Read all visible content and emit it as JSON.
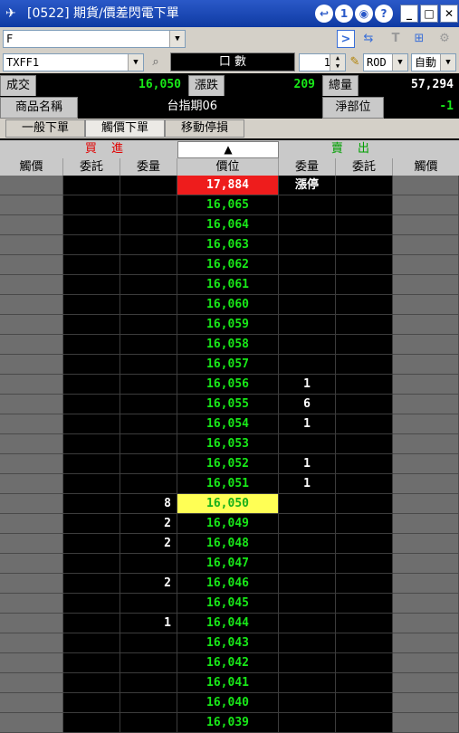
{
  "window": {
    "title": "[0522] 期貨/價差閃電下單",
    "buttons": [
      "↩",
      "1",
      "◉",
      "?"
    ]
  },
  "toolbar": {
    "account_value": "F",
    "symbol_value": "TXFF1",
    "qty_label": "口 數",
    "qty_value": "1",
    "order_type": "ROD",
    "mode": "自動"
  },
  "info": {
    "last_label": "成交",
    "last_value": "16,050",
    "change_label": "漲跌",
    "change_value": "209",
    "volume_label": "總量",
    "volume_value": "57,294",
    "name_label": "商品名稱",
    "name_value": "台指期06",
    "position_label": "淨部位",
    "position_value": "-1"
  },
  "tabs": [
    "一般下單",
    "觸價下單",
    "移動停損"
  ],
  "book_header": {
    "buy": "買 進",
    "sell": "賣 出",
    "center": "▲"
  },
  "columns": [
    "觸價",
    "委託",
    "委量",
    "價位",
    "委量",
    "委託",
    "觸價"
  ],
  "colors": {
    "price_green": "#18e818",
    "limit_up_bg": "#ee1c1c",
    "last_price_bg": "#ffff55",
    "buy_red": "#e00000",
    "sell_green": "#00a000"
  },
  "rows": [
    {
      "price": "17,884",
      "buy_qty": "",
      "sell_qty": "漲停",
      "state": "limit-up"
    },
    {
      "price": "16,065",
      "buy_qty": "",
      "sell_qty": "",
      "state": ""
    },
    {
      "price": "16,064",
      "buy_qty": "",
      "sell_qty": "",
      "state": ""
    },
    {
      "price": "16,063",
      "buy_qty": "",
      "sell_qty": "",
      "state": ""
    },
    {
      "price": "16,062",
      "buy_qty": "",
      "sell_qty": "",
      "state": ""
    },
    {
      "price": "16,061",
      "buy_qty": "",
      "sell_qty": "",
      "state": ""
    },
    {
      "price": "16,060",
      "buy_qty": "",
      "sell_qty": "",
      "state": ""
    },
    {
      "price": "16,059",
      "buy_qty": "",
      "sell_qty": "",
      "state": ""
    },
    {
      "price": "16,058",
      "buy_qty": "",
      "sell_qty": "",
      "state": ""
    },
    {
      "price": "16,057",
      "buy_qty": "",
      "sell_qty": "",
      "state": ""
    },
    {
      "price": "16,056",
      "buy_qty": "",
      "sell_qty": "1",
      "state": ""
    },
    {
      "price": "16,055",
      "buy_qty": "",
      "sell_qty": "6",
      "state": ""
    },
    {
      "price": "16,054",
      "buy_qty": "",
      "sell_qty": "1",
      "state": ""
    },
    {
      "price": "16,053",
      "buy_qty": "",
      "sell_qty": "",
      "state": ""
    },
    {
      "price": "16,052",
      "buy_qty": "",
      "sell_qty": "1",
      "state": ""
    },
    {
      "price": "16,051",
      "buy_qty": "",
      "sell_qty": "1",
      "state": ""
    },
    {
      "price": "16,050",
      "buy_qty": "8",
      "sell_qty": "",
      "state": "last"
    },
    {
      "price": "16,049",
      "buy_qty": "2",
      "sell_qty": "",
      "state": ""
    },
    {
      "price": "16,048",
      "buy_qty": "2",
      "sell_qty": "",
      "state": ""
    },
    {
      "price": "16,047",
      "buy_qty": "",
      "sell_qty": "",
      "state": ""
    },
    {
      "price": "16,046",
      "buy_qty": "2",
      "sell_qty": "",
      "state": ""
    },
    {
      "price": "16,045",
      "buy_qty": "",
      "sell_qty": "",
      "state": ""
    },
    {
      "price": "16,044",
      "buy_qty": "1",
      "sell_qty": "",
      "state": ""
    },
    {
      "price": "16,043",
      "buy_qty": "",
      "sell_qty": "",
      "state": ""
    },
    {
      "price": "16,042",
      "buy_qty": "",
      "sell_qty": "",
      "state": ""
    },
    {
      "price": "16,041",
      "buy_qty": "",
      "sell_qty": "",
      "state": ""
    },
    {
      "price": "16,040",
      "buy_qty": "",
      "sell_qty": "",
      "state": ""
    },
    {
      "price": "16,039",
      "buy_qty": "",
      "sell_qty": "",
      "state": ""
    }
  ]
}
